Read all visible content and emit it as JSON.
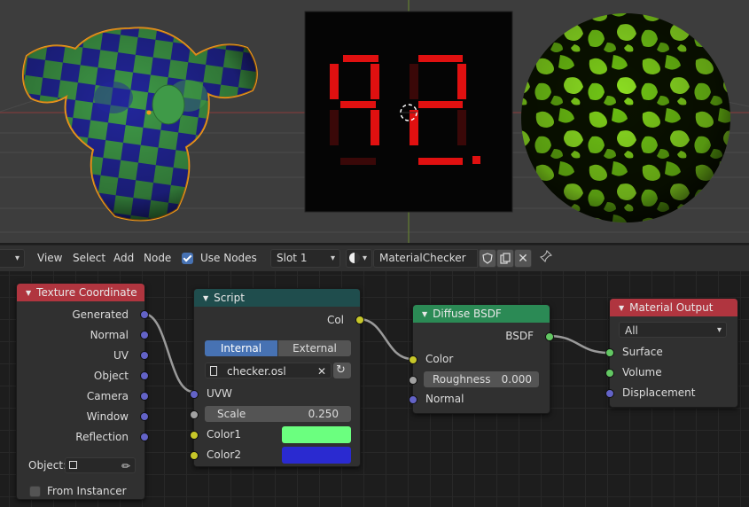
{
  "header": {
    "menu": [
      "View",
      "Select",
      "Add",
      "Node"
    ],
    "use_nodes_label": "Use Nodes",
    "use_nodes_checked": true,
    "slot": "Slot 1",
    "material_name": "MaterialChecker"
  },
  "nodes": {
    "texture_coordinate": {
      "title": "Texture Coordinate",
      "outputs": [
        "Generated",
        "Normal",
        "UV",
        "Object",
        "Camera",
        "Window",
        "Reflection"
      ],
      "object_label": "Object:",
      "from_instancer_label": "From Instancer"
    },
    "script": {
      "title": "Script",
      "output": "Col",
      "mode_internal": "Internal",
      "mode_external": "External",
      "file": "checker.osl",
      "uvw_label": "UVW",
      "scale_label": "Scale",
      "scale_value": "0.250",
      "color1_label": "Color1",
      "color2_label": "Color2",
      "color1": "#6bff7f",
      "color2": "#2a2ad0"
    },
    "diffuse": {
      "title": "Diffuse BSDF",
      "output": "BSDF",
      "color_label": "Color",
      "roughness_label": "Roughness",
      "roughness_value": "0.000",
      "normal_label": "Normal"
    },
    "material_output": {
      "title": "Material Output",
      "target": "All",
      "surface_label": "Surface",
      "volume_label": "Volume",
      "displacement_label": "Displacement"
    }
  },
  "colors": {
    "header_texcoord": "#b0353f",
    "header_script": "#1f4d4d",
    "header_diffuse": "#2b8a55",
    "header_output": "#b0353f",
    "accent": "#4772b3"
  }
}
